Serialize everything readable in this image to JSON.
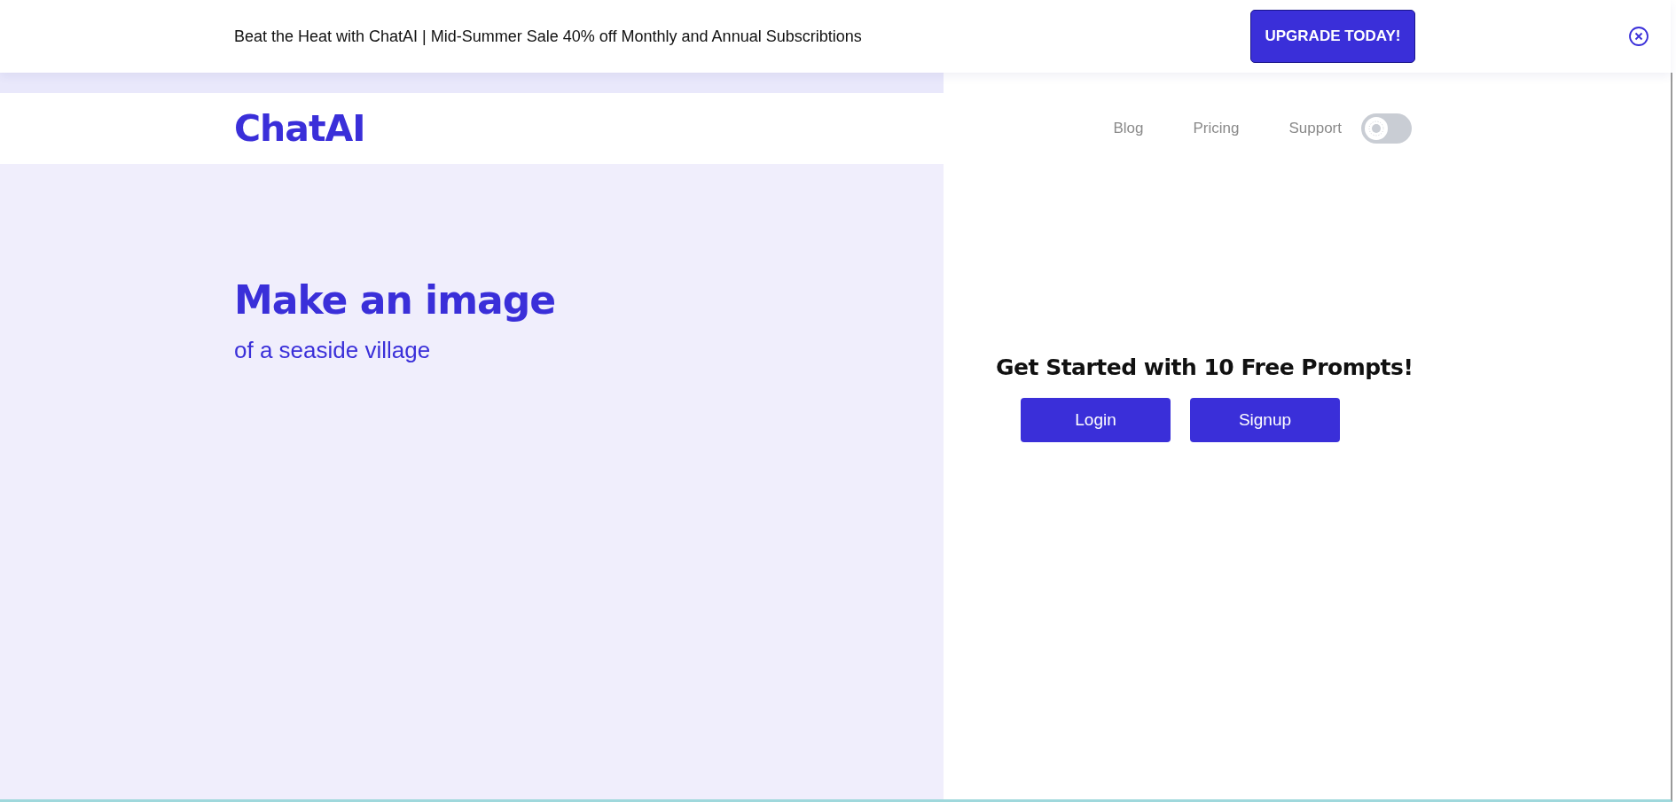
{
  "promo_banner": {
    "text": "Beat the Heat with ChatAI | Mid-Summer Sale 40% off Monthly and Annual Subscribtions",
    "button": "UPGRADE TODAY!"
  },
  "header": {
    "logo": "ChatAI",
    "nav": [
      "Blog",
      "Pricing",
      "Support"
    ],
    "dark_mode": false
  },
  "hero": {
    "title": "Make an image",
    "subtitle": "of a seaside village"
  },
  "signup_panel": {
    "heading": "Get Started with 10 Free Prompts!",
    "buttons": [
      "Login",
      "Signup"
    ]
  }
}
